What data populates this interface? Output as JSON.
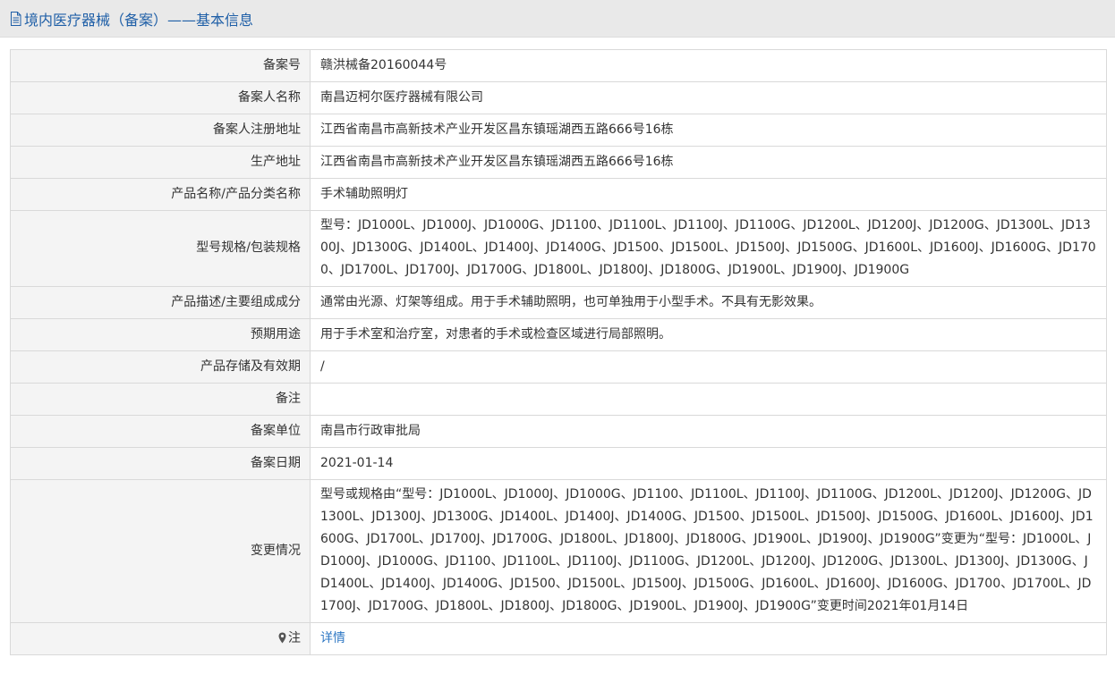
{
  "header": {
    "title": "境内医疗器械（备案）——基本信息"
  },
  "rows": [
    {
      "label": "备案号",
      "value": "赣洪械备20160044号"
    },
    {
      "label": "备案人名称",
      "value": "南昌迈柯尔医疗器械有限公司"
    },
    {
      "label": "备案人注册地址",
      "value": "江西省南昌市高新技术产业开发区昌东镇瑶湖西五路666号16栋"
    },
    {
      "label": "生产地址",
      "value": "江西省南昌市高新技术产业开发区昌东镇瑶湖西五路666号16栋"
    },
    {
      "label": "产品名称/产品分类名称",
      "value": "手术辅助照明灯"
    },
    {
      "label": "型号规格/包装规格",
      "value": "型号：JD1000L、JD1000J、JD1000G、JD1100、JD1100L、JD1100J、JD1100G、JD1200L、JD1200J、JD1200G、JD1300L、JD1300J、JD1300G、JD1400L、JD1400J、JD1400G、JD1500、JD1500L、JD1500J、JD1500G、JD1600L、JD1600J、JD1600G、JD1700、JD1700L、JD1700J、JD1700G、JD1800L、JD1800J、JD1800G、JD1900L、JD1900J、JD1900G"
    },
    {
      "label": "产品描述/主要组成成分",
      "value": "通常由光源、灯架等组成。用于手术辅助照明，也可单独用于小型手术。不具有无影效果。"
    },
    {
      "label": "预期用途",
      "value": "用于手术室和治疗室，对患者的手术或检查区域进行局部照明。"
    },
    {
      "label": "产品存储及有效期",
      "value": "/"
    },
    {
      "label": "备注",
      "value": ""
    },
    {
      "label": "备案单位",
      "value": "南昌市行政审批局"
    },
    {
      "label": "备案日期",
      "value": "2021-01-14"
    },
    {
      "label": "变更情况",
      "value": "型号或规格由“型号：JD1000L、JD1000J、JD1000G、JD1100、JD1100L、JD1100J、JD1100G、JD1200L、JD1200J、JD1200G、JD1300L、JD1300J、JD1300G、JD1400L、JD1400J、JD1400G、JD1500、JD1500L、JD1500J、JD1500G、JD1600L、JD1600J、JD1600G、JD1700L、JD1700J、JD1700G、JD1800L、JD1800J、JD1800G、JD1900L、JD1900J、JD1900G”变更为“型号：JD1000L、JD1000J、JD1000G、JD1100、JD1100L、JD1100J、JD1100G、JD1200L、JD1200J、JD1200G、JD1300L、JD1300J、JD1300G、JD1400L、JD1400J、JD1400G、JD1500、JD1500L、JD1500J、JD1500G、JD1600L、JD1600J、JD1600G、JD1700、JD1700L、JD1700J、JD1700G、JD1800L、JD1800J、JD1800G、JD1900L、JD1900J、JD1900G”变更时间2021年01月14日"
    }
  ],
  "note": {
    "label": "注",
    "link_text": "详情",
    "icon": "map-pin-icon"
  },
  "colors": {
    "title": "#1f5fa7",
    "link": "#2f78c4",
    "label_bg": "#f4f4f4",
    "header_bg": "#e9e9e9",
    "border": "#d9d9d9"
  }
}
